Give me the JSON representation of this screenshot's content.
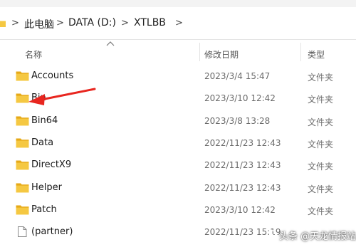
{
  "address_bar": {
    "crumbs": [
      "此电脑",
      "DATA (D:)",
      "XTLBB"
    ],
    "separator": ">"
  },
  "columns": {
    "name": "名称",
    "modified": "修改日期",
    "type": "类型"
  },
  "files": [
    {
      "name": "Accounts",
      "modified": "2023/3/4 15:47",
      "type": "文件夹",
      "icon": "folder-icon"
    },
    {
      "name": "Bin",
      "modified": "2023/3/10 12:42",
      "type": "文件夹",
      "icon": "folder-icon"
    },
    {
      "name": "Bin64",
      "modified": "2023/3/8 13:28",
      "type": "文件夹",
      "icon": "folder-icon"
    },
    {
      "name": "Data",
      "modified": "2022/11/23 12:43",
      "type": "文件夹",
      "icon": "folder-icon"
    },
    {
      "name": "DirectX9",
      "modified": "2022/11/23 12:43",
      "type": "文件夹",
      "icon": "folder-icon"
    },
    {
      "name": "Helper",
      "modified": "2022/11/23 12:43",
      "type": "文件夹",
      "icon": "folder-icon"
    },
    {
      "name": "Patch",
      "modified": "2023/3/10 12:42",
      "type": "文件夹",
      "icon": "folder-icon"
    },
    {
      "name": "(partner)",
      "modified": "2022/11/23 15:19",
      "type": "",
      "icon": "file-icon"
    }
  ],
  "annotation": {
    "target": "Bin",
    "color": "#e8261f"
  },
  "watermark": {
    "text": "头条 @天龙情报站"
  },
  "colors": {
    "folder": "#f5c842",
    "folder_dark": "#e6a917",
    "arrow": "#e8261f"
  }
}
